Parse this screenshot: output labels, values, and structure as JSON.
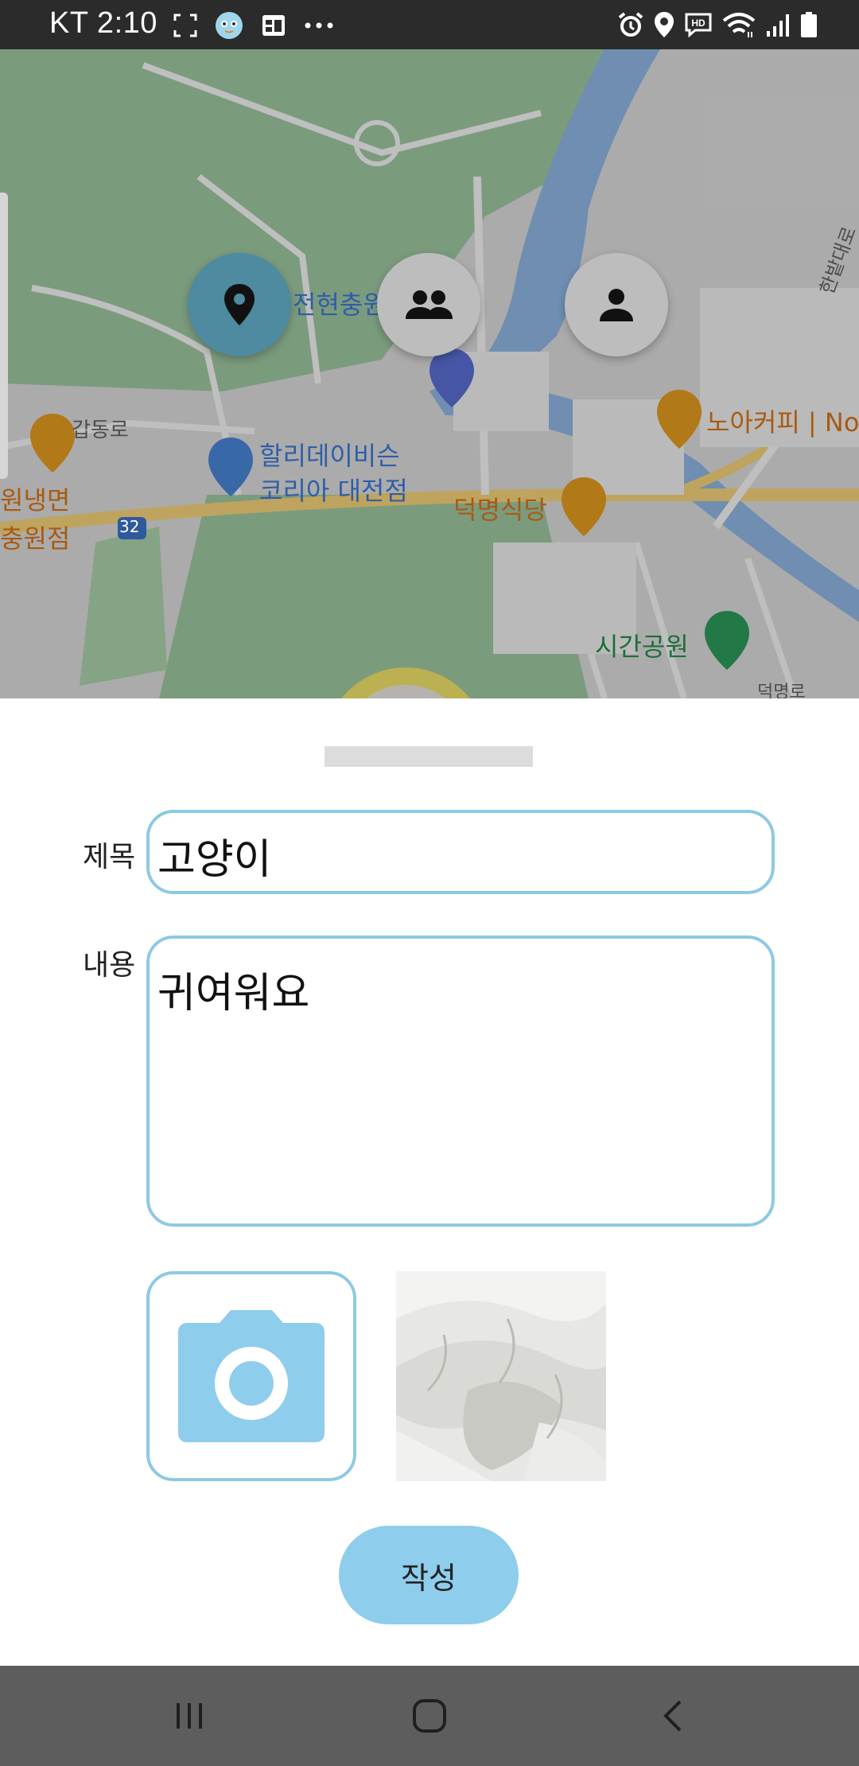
{
  "status_bar": {
    "time": "KT 2:10"
  },
  "map": {
    "labels": {
      "place_1": "전현충원",
      "road_1": "갑동로",
      "restaurant_1_line1": "원냉면",
      "restaurant_1_line2": "충원점",
      "road_number": "32",
      "store_line1": "할리데이비슨",
      "store_line2": "코리아 대전점",
      "restaurant_2": "덕명식당",
      "cafe": "노아커피 | No",
      "park": "시간공원",
      "road_2": "한밭대로",
      "road_3": "덕명로"
    },
    "buttons": {
      "location_icon": "location-pin-icon",
      "group_icon": "group-icon",
      "person_icon": "person-icon"
    }
  },
  "form": {
    "title_label": "제목",
    "title_value": "고양이",
    "content_label": "내용",
    "content_value": "귀여워요",
    "submit_label": "작성"
  },
  "colors": {
    "accent_border": "#8ec9e2",
    "submit_bg": "#8ecdec",
    "camera_icon": "#8ecdec",
    "active_fab": "#4e8aa0"
  }
}
